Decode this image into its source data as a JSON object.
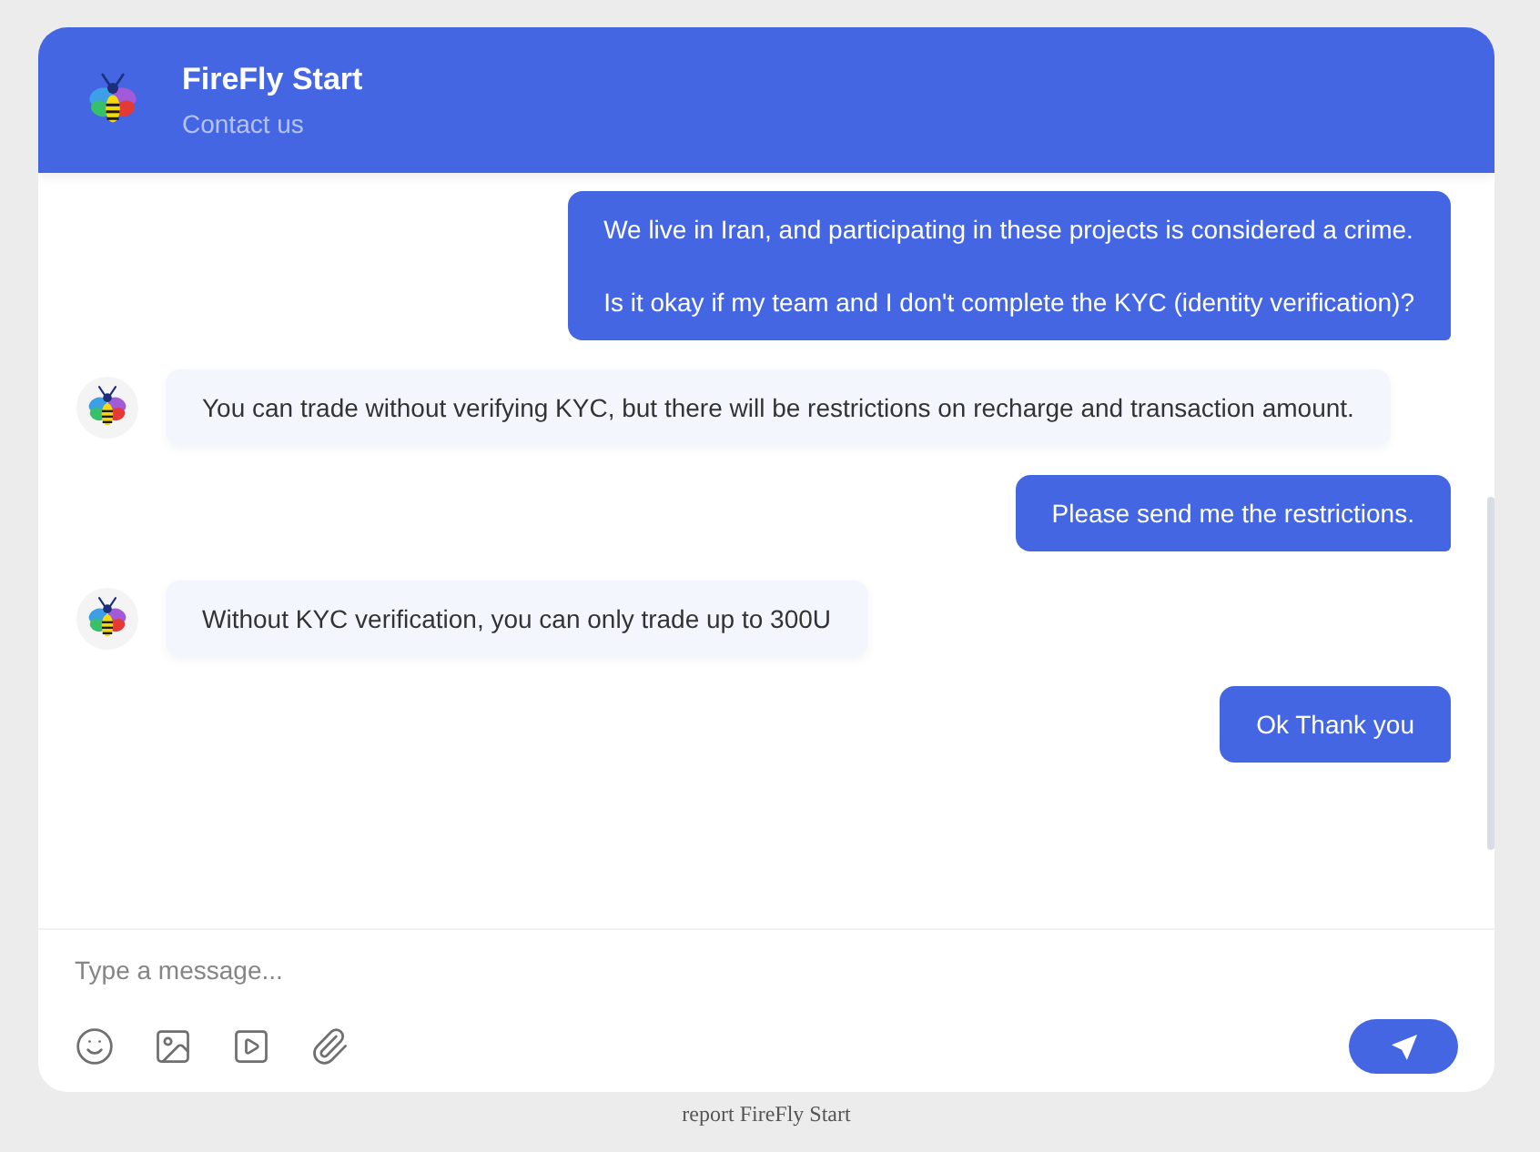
{
  "header": {
    "title": "FireFly Start",
    "subtitle": "Contact us"
  },
  "messages": [
    {
      "kind": "sent",
      "paragraphs": [
        "We live in Iran, and participating in these projects is considered a crime.",
        "Is it okay if my team and I don't complete the KYC (identity verification)?"
      ]
    },
    {
      "kind": "received",
      "paragraphs": [
        "You can trade without verifying KYC, but there will be restrictions on recharge and transaction amount."
      ]
    },
    {
      "kind": "sent",
      "paragraphs": [
        "Please send me the restrictions."
      ]
    },
    {
      "kind": "received",
      "paragraphs": [
        "Without KYC verification, you can only trade up to 300U"
      ]
    },
    {
      "kind": "sent",
      "paragraphs": [
        "Ok Thank you"
      ]
    }
  ],
  "composer": {
    "placeholder": "Type a message..."
  },
  "footer": {
    "link": "report FireFly Start"
  }
}
